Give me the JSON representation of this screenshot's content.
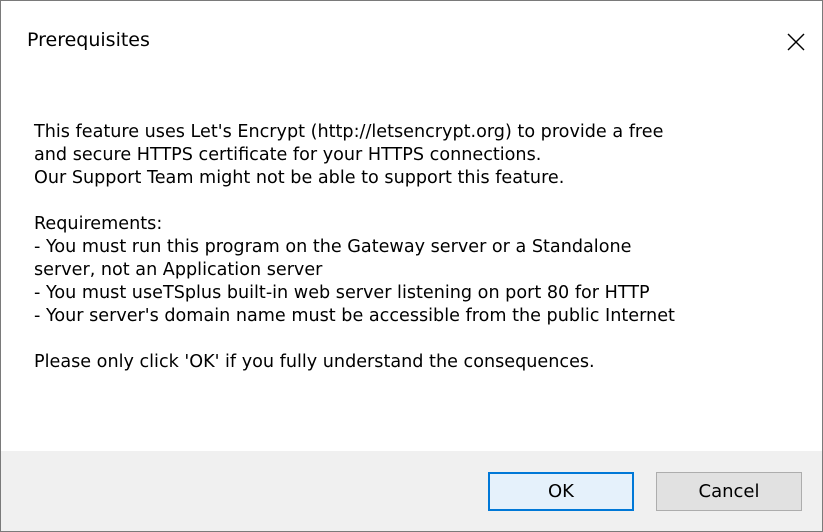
{
  "window": {
    "title": "Prerequisites",
    "close_icon": "close-icon"
  },
  "message": {
    "intro_lines": [
      "This feature uses Let's Encrypt (http://letsencrypt.org) to provide a free",
      "and secure HTTPS certificate for your HTTPS connections.",
      "Our Support Team might not be able to support this feature."
    ],
    "requirements_heading": "Requirements:",
    "requirements_lines": [
      "- You must run this program on the Gateway server or a Standalone",
      "server, not an Application server",
      "- You must useTSplus built-in web server listening on port 80 for HTTP",
      "- Your server's domain name must be accessible from the public Internet"
    ],
    "closing": "Please only click 'OK' if you fully understand the consequences."
  },
  "buttons": {
    "ok_label": "OK",
    "cancel_label": "Cancel"
  },
  "colors": {
    "footer_bg": "#f0f0f0",
    "default_button_border": "#0078d7"
  }
}
